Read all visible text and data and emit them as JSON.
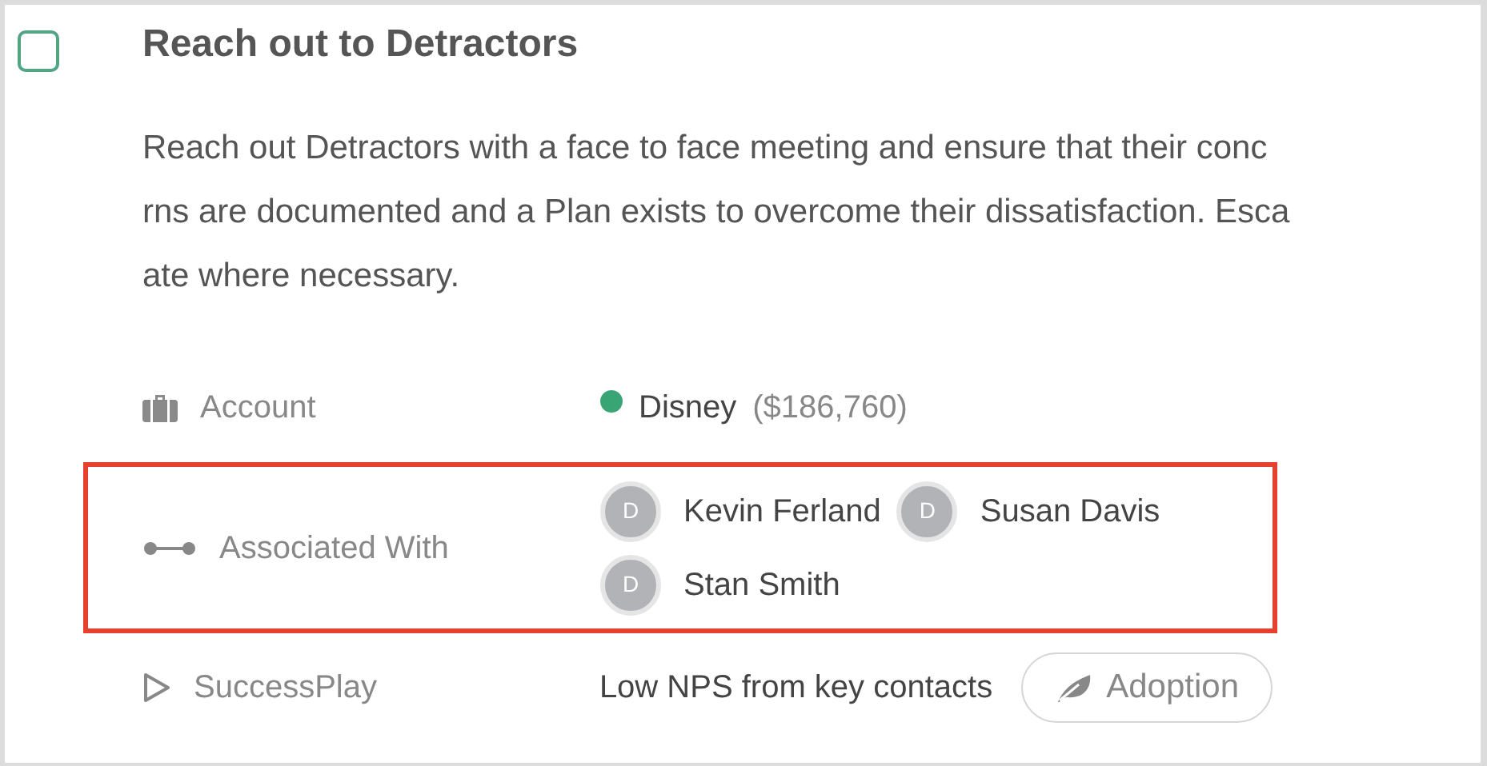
{
  "task": {
    "checked": false,
    "title": "Reach out to Detractors",
    "description_lines": [
      "Reach out Detractors with a face to face meeting and ensure that their conc",
      "rns are documented and a Plan exists to overcome their dissatisfaction. Esca",
      "ate where necessary."
    ]
  },
  "fields": [
    {
      "kind": "account",
      "label": "Account",
      "color": "#3aa574",
      "name": "Disney",
      "amount": "($186,760)"
    },
    {
      "kind": "contacts",
      "label": "Associated With",
      "highlighted": true,
      "contacts": [
        {
          "initial": "D",
          "name": "Kevin Ferland"
        },
        {
          "initial": "D",
          "name": "Susan Davis"
        },
        {
          "initial": "D",
          "name": "Stan Smith"
        }
      ]
    },
    {
      "kind": "play",
      "label": "SuccessPlay",
      "value": "Low NPS from key contacts",
      "tag": "Adoption"
    }
  ]
}
